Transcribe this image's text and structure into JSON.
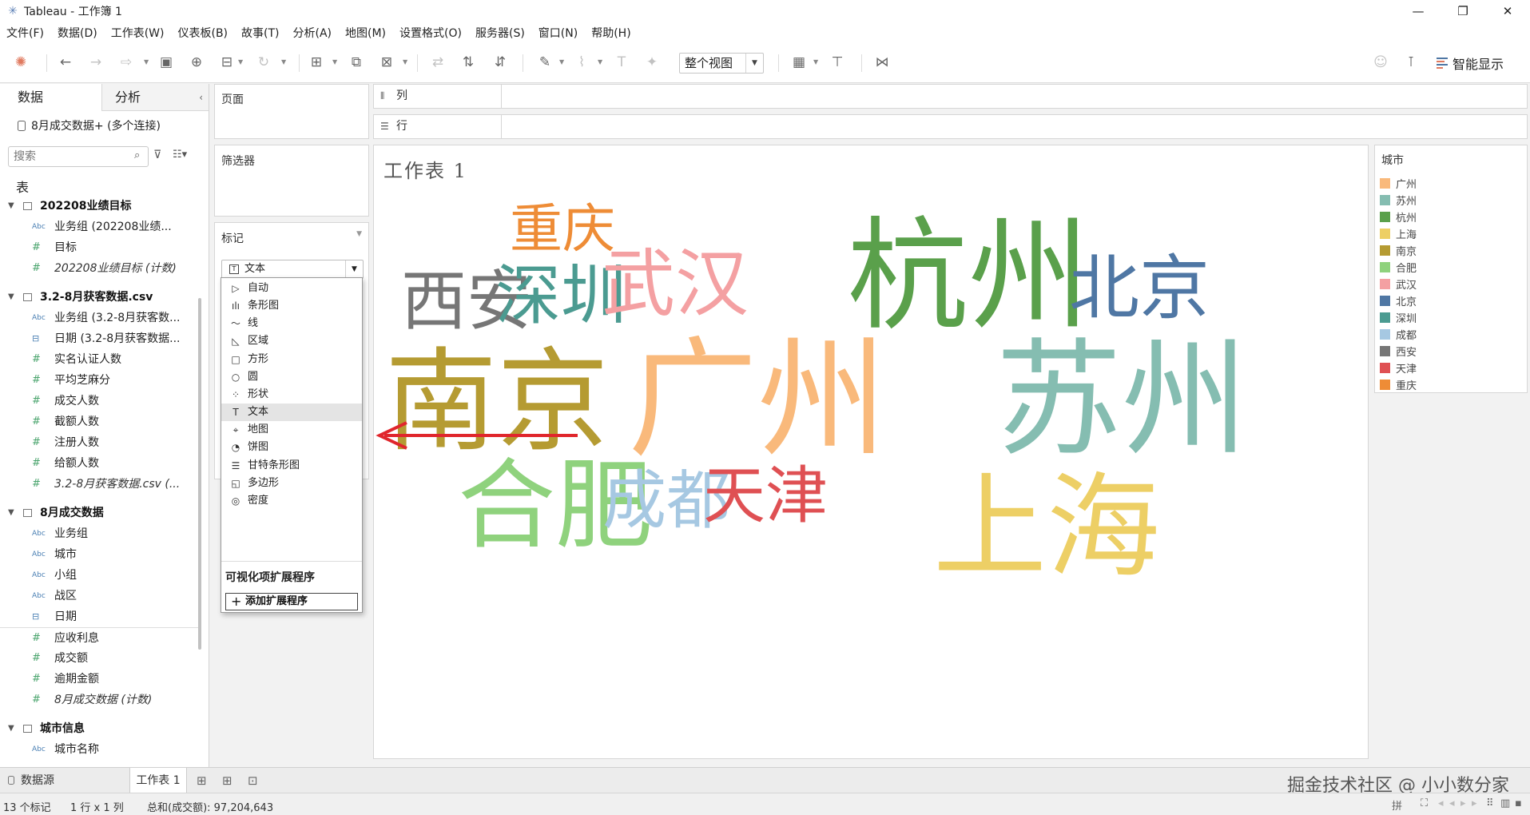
{
  "window": {
    "title": "Tableau - 工作簿 1",
    "controls": [
      "—",
      "❐",
      "✕"
    ]
  },
  "menu": [
    "文件(F)",
    "数据(D)",
    "工作表(W)",
    "仪表板(B)",
    "故事(T)",
    "分析(A)",
    "地图(M)",
    "设置格式(O)",
    "服务器(S)",
    "窗口(N)",
    "帮助(H)"
  ],
  "toolbar": {
    "view_size": "整个视图",
    "smart_show": "智能显示"
  },
  "data_pane": {
    "tabs": [
      "数据",
      "分析"
    ],
    "connection": "8月成交数据+ (多个连接)",
    "search_placeholder": "搜索",
    "tables_heading": "表",
    "groups": [
      {
        "name": "202208业绩目标",
        "fields": [
          {
            "type": "Abc",
            "name": "业务组 (202208业绩..."
          },
          {
            "type": "#",
            "name": "目标"
          },
          {
            "type": "#",
            "name": "202208业绩目标 (计数)",
            "italic": true
          }
        ]
      },
      {
        "name": "3.2-8月获客数据.csv",
        "fields": [
          {
            "type": "Abc",
            "name": "业务组 (3.2-8月获客数..."
          },
          {
            "type": "date",
            "name": "日期 (3.2-8月获客数据..."
          },
          {
            "type": "#",
            "name": "实名认证人数"
          },
          {
            "type": "#",
            "name": "平均芝麻分"
          },
          {
            "type": "#",
            "name": "成交人数"
          },
          {
            "type": "#",
            "name": "截额人数"
          },
          {
            "type": "#",
            "name": "注册人数"
          },
          {
            "type": "#",
            "name": "给额人数"
          },
          {
            "type": "#",
            "name": "3.2-8月获客数据.csv (...",
            "italic": true
          }
        ]
      },
      {
        "name": "8月成交数据",
        "fields": [
          {
            "type": "Abc",
            "name": "业务组"
          },
          {
            "type": "Abc",
            "name": "城市"
          },
          {
            "type": "Abc",
            "name": "小组"
          },
          {
            "type": "Abc",
            "name": "战区"
          },
          {
            "type": "date",
            "name": "日期"
          },
          {
            "type": "#",
            "name": "应收利息",
            "sep": true
          },
          {
            "type": "#",
            "name": "成交额"
          },
          {
            "type": "#",
            "name": "逾期金额"
          },
          {
            "type": "#",
            "name": "8月成交数据 (计数)",
            "italic": true
          }
        ]
      },
      {
        "name": "城市信息",
        "fields": [
          {
            "type": "Abc",
            "name": "城市名称"
          }
        ]
      }
    ]
  },
  "shelves": {
    "pages": "页面",
    "filters": "筛选器",
    "marks": "标记",
    "columns": "列",
    "rows": "行"
  },
  "marks_card": {
    "selected_type": "文本",
    "dropdown": [
      {
        "icon": "▷",
        "label": "自动"
      },
      {
        "icon": "ılı",
        "label": "条形图"
      },
      {
        "icon": "〜",
        "label": "线"
      },
      {
        "icon": "◺",
        "label": "区域"
      },
      {
        "icon": "□",
        "label": "方形"
      },
      {
        "icon": "○",
        "label": "圆"
      },
      {
        "icon": "⁘",
        "label": "形状"
      },
      {
        "icon": "T",
        "label": "文本",
        "selected": true
      },
      {
        "icon": "⌖",
        "label": "地图"
      },
      {
        "icon": "◔",
        "label": "饼图"
      },
      {
        "icon": "☰",
        "label": "甘特条形图"
      },
      {
        "icon": "◱",
        "label": "多边形"
      },
      {
        "icon": "◎",
        "label": "密度"
      }
    ],
    "extensions_heading": "可视化项扩展程序",
    "add_extension": "添加扩展程序"
  },
  "sheet": {
    "title": "工作表 1"
  },
  "legend": {
    "title": "城市",
    "items": [
      {
        "name": "广州",
        "color": "#f9b97b"
      },
      {
        "name": "苏州",
        "color": "#85bdb1"
      },
      {
        "name": "杭州",
        "color": "#5aa04b"
      },
      {
        "name": "上海",
        "color": "#edcf65"
      },
      {
        "name": "南京",
        "color": "#b59b32"
      },
      {
        "name": "合肥",
        "color": "#8fd27d"
      },
      {
        "name": "武汉",
        "color": "#f4a0a2"
      },
      {
        "name": "北京",
        "color": "#4f77a4"
      },
      {
        "name": "深圳",
        "color": "#4b9b91"
      },
      {
        "name": "成都",
        "color": "#a6c8e2"
      },
      {
        "name": "西安",
        "color": "#767676"
      },
      {
        "name": "天津",
        "color": "#df5053"
      },
      {
        "name": "重庆",
        "color": "#ee8c36"
      }
    ]
  },
  "word_cloud": [
    {
      "text": "重庆",
      "color": "#ee8c36"
    },
    {
      "text": "杭州",
      "color": "#5aa04b"
    },
    {
      "text": "西安",
      "color": "#767676"
    },
    {
      "text": "深圳",
      "color": "#4b9b91"
    },
    {
      "text": "武汉",
      "color": "#f4a0a2"
    },
    {
      "text": "北京",
      "color": "#4f77a4"
    },
    {
      "text": "南京",
      "color": "#b59b32"
    },
    {
      "text": "广州",
      "color": "#f9b97b"
    },
    {
      "text": "苏州",
      "color": "#85bdb1"
    },
    {
      "text": "合肥",
      "color": "#8fd27d"
    },
    {
      "text": "成都",
      "color": "#a6c8e2"
    },
    {
      "text": "天津",
      "color": "#df5053"
    },
    {
      "text": "上海",
      "color": "#edcf65"
    }
  ],
  "bottom_tabs": {
    "datasource": "数据源",
    "sheet": "工作表 1"
  },
  "watermark": "掘金技术社区 @ 小小数分家",
  "status": {
    "marks": "13 个标记",
    "rows_cols": "1 行 x 1 列",
    "sum": "总和(成交额): 97,204,643"
  }
}
